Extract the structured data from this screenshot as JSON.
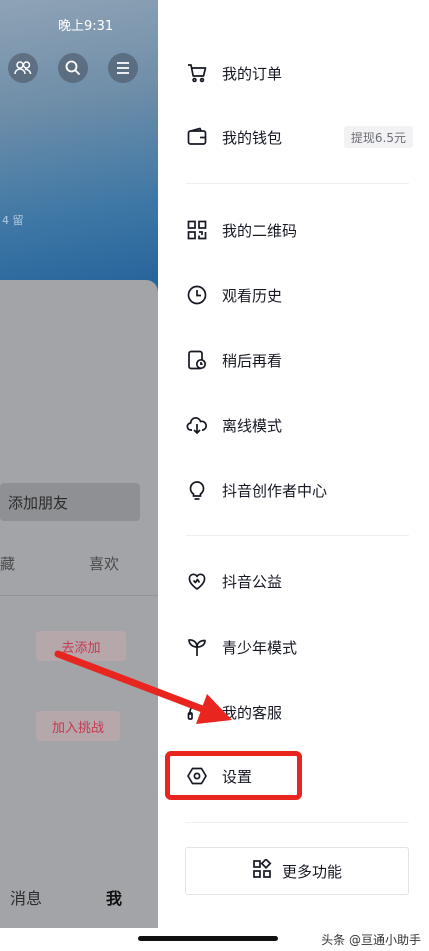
{
  "status_bar": {
    "time": "晚上9:31"
  },
  "left_panel": {
    "header_small_text": "4 留",
    "add_friends_label": "添加朋友",
    "tabs": [
      "藏",
      "喜欢"
    ],
    "actions": [
      "去添加",
      "加入挑战"
    ],
    "bottom_nav": [
      "消息",
      "我"
    ]
  },
  "drawer": {
    "items": [
      {
        "label": "我的订单",
        "icon": "cart-icon"
      },
      {
        "label": "我的钱包",
        "icon": "wallet-icon",
        "badge": "提现6.5元"
      },
      {
        "label": "我的二维码",
        "icon": "qrcode-icon"
      },
      {
        "label": "观看历史",
        "icon": "clock-icon"
      },
      {
        "label": "稍后再看",
        "icon": "watch-later-icon"
      },
      {
        "label": "离线模式",
        "icon": "cloud-download-icon"
      },
      {
        "label": "抖音创作者中心",
        "icon": "lightbulb-icon"
      },
      {
        "label": "抖音公益",
        "icon": "heart-charity-icon"
      },
      {
        "label": "青少年模式",
        "icon": "sprout-icon"
      },
      {
        "label": "我的客服",
        "icon": "headset-icon"
      },
      {
        "label": "设置",
        "icon": "settings-hexagon-icon"
      }
    ],
    "more_label": "更多功能"
  },
  "annotation": {
    "highlight_color": "#e8261f"
  },
  "watermark": "头条 @亘通小助手",
  "colors": {
    "accent_red": "#e8261f",
    "pill_text": "#c43a4f"
  }
}
